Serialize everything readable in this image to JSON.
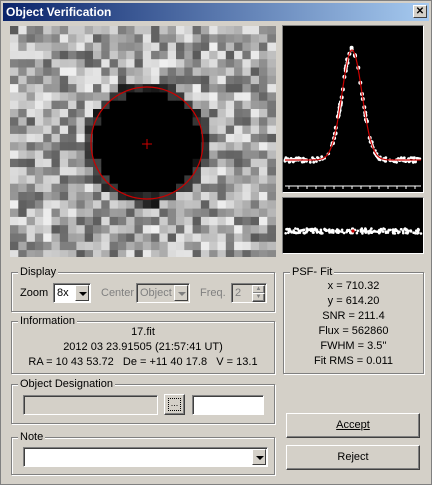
{
  "window": {
    "title": "Object Verification",
    "close_glyph": "✕"
  },
  "display": {
    "group_label": "Display",
    "zoom_label": "Zoom",
    "zoom_value": "8x",
    "center_label": "Center",
    "center_value": "Object",
    "freq_label": "Freq.",
    "freq_value": "2"
  },
  "information": {
    "group_label": "Information",
    "filename": "17.fit",
    "datetime": "2012 03 23.91505 (21:57:41 UT)",
    "coords": "RA = 10 43 53.72   De = +11 40 17.8   V = 13.1"
  },
  "psf_fit": {
    "group_label": "PSF- Fit",
    "x": "x = 710.32",
    "y": "y = 614.20",
    "snr": "SNR = 211.4",
    "flux": "Flux = 562860",
    "fwhm": "FWHM = 3.5''",
    "fit_rms": "Fit RMS = 0.011"
  },
  "designation": {
    "group_label": "Object Designation",
    "value": "",
    "code": ""
  },
  "note": {
    "group_label": "Note",
    "value": ""
  },
  "buttons": {
    "accept": "Accept",
    "reject": "Reject"
  },
  "colors": {
    "title_start": "#0a246a",
    "title_end": "#a6caf0",
    "fit_curve": "#cc0000",
    "marker": "#cc0000"
  }
}
